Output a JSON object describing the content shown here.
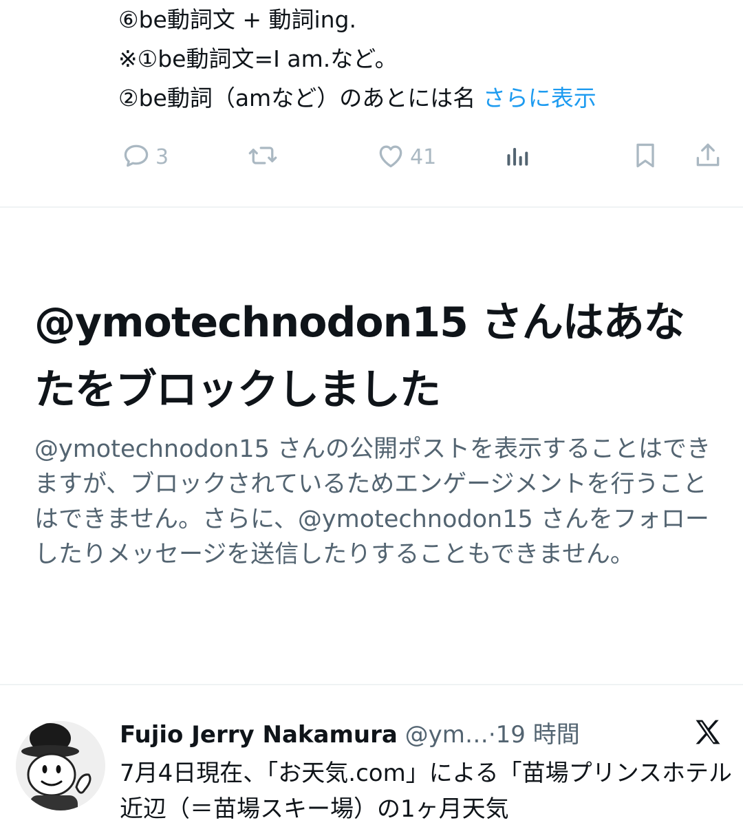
{
  "tweet_top": {
    "lines": [
      "⑥be動詞文 + 動詞ing.",
      "※①be動詞文=I am.など。",
      "②be動詞（amなど）のあとには名"
    ],
    "show_more": "さらに表示",
    "reply_count": "3",
    "like_count": "41"
  },
  "block_notice": {
    "title": "@ymotechnodon15 さんはあなたをブロックしました",
    "body": "@ymotechnodon15 さんの公開ポストを表示することはできますが、ブロックされているためエンゲージメントを行うことはできません。さらに、@ymotechnodon15 さんをフォローしたりメッセージを送信したりすることもできません。"
  },
  "tweet_bottom": {
    "author_name": "Fujio Jerry Nakamura",
    "author_handle": "@ym…",
    "separator": "·",
    "time": "19 時間",
    "text": "7月4日現在、「お天気.com」による「苗場プリンスホテル近辺（＝苗場スキー場）の1ヶ月天気"
  },
  "colors": {
    "accent": "#1d9bf0",
    "muted": "#536471",
    "icon": "#aab8c2",
    "divider": "#eff3f4"
  },
  "icons": [
    "reply-icon",
    "retweet-icon",
    "like-icon",
    "views-icon",
    "bookmark-icon",
    "share-icon",
    "x-logo-icon"
  ]
}
